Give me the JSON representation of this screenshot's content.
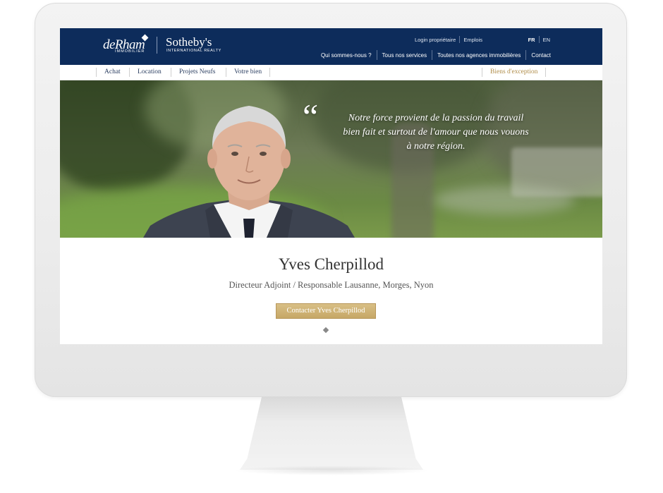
{
  "header": {
    "logo_left_main": "deRham",
    "logo_left_sub": "IMMOBILIER",
    "logo_right_main": "Sotheby's",
    "logo_right_sub": "INTERNATIONAL REALTY",
    "util_links": [
      "Login propriétaire",
      "Emplois"
    ],
    "languages": [
      {
        "label": "FR",
        "active": true
      },
      {
        "label": "EN",
        "active": false
      }
    ],
    "main_nav": [
      "Qui sommes-nous ?",
      "Tous nos services",
      "Toutes nos agences immobilières",
      "Contact"
    ]
  },
  "sub_nav": {
    "items": [
      "Achat",
      "Location",
      "Projets Neufs",
      "Votre bien"
    ],
    "exception": "Biens d'exception"
  },
  "hero": {
    "quote_line1": "Notre force provient de la passion du travail",
    "quote_line2": "bien fait et surtout de l'amour que nous vouons",
    "quote_line3": "à notre région.",
    "quote_mark": "“"
  },
  "profile": {
    "name": "Yves Cherpillod",
    "title": "Directeur Adjoint / Responsable Lausanne, Morges, Nyon",
    "contact_label": "Contacter Yves Cherpillod"
  },
  "colors": {
    "header_bg": "#0d2c5b",
    "accent_gold": "#c6a766",
    "exception_text": "#b08d4a"
  }
}
